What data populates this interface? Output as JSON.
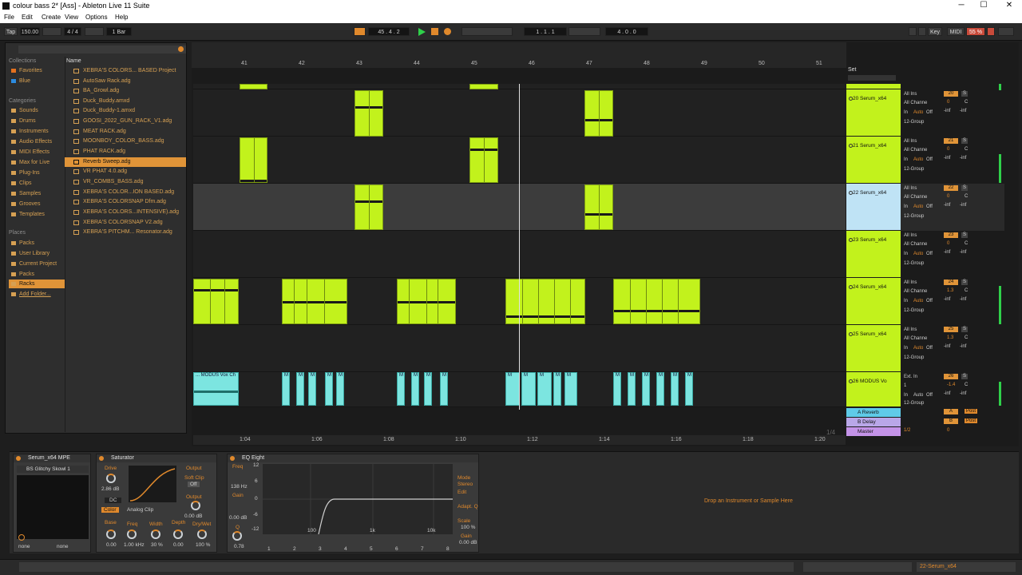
{
  "window": {
    "title": "colour bass 2* [Ass] - Ableton Live 11 Suite",
    "controls": [
      "─",
      "☐",
      "✕"
    ]
  },
  "menu": [
    "File",
    "Edit",
    "Create",
    "View",
    "Options",
    "Help"
  ],
  "controlbar": {
    "tap": "Tap",
    "tempo": "150.00",
    "signature": "4 / 4",
    "metro": "1 Bar",
    "position": "45 .  4 .  2",
    "loop_start": "1 .  1 .  1",
    "loop_length": "4 .  0 .  0",
    "key": "Key",
    "midi": "MIDI",
    "cpu": "55 %"
  },
  "browser": {
    "collections_head": "Collections",
    "collections": [
      {
        "label": "Favorites"
      },
      {
        "label": "Blue"
      }
    ],
    "categories_head": "Categories",
    "categories": [
      "Sounds",
      "Drums",
      "Instruments",
      "Audio Effects",
      "MIDI Effects",
      "Max for Live",
      "Plug-Ins",
      "Clips",
      "Samples",
      "Grooves",
      "Templates"
    ],
    "places_head": "Places",
    "places": [
      "Packs",
      "User Library",
      "Current Project",
      "Packs",
      "Racks",
      "Add Folder..."
    ],
    "name_head": "Name",
    "files": [
      "XEBRA'S COLORS... BASED Project",
      "AutoSaw Rack.adg",
      "BA_Growl.adg",
      "Duck_Buddy.amxd",
      "Duck_Buddy-1.amxd",
      "GOOSI_2022_GUN_RACK_V1.adg",
      "MEAT RACK.adg",
      "MOONBOY_COLOR_BASS.adg",
      "PHAT RACK.adg",
      "Reverb Sweep.adg",
      "VR PHAT 4.0.adg",
      "VR_COMBS_BASS.adg",
      "XEBRA'S COLOR...ION BASED.adg",
      "XEBRA'S COLORSNAP Dfm.adg",
      "XEBRA'S COLORS...INTENSIVE).adg",
      "XEBRA'S COLORSNAP V2.adg",
      "XEBRA'S PITCHM... Resonator.adg"
    ]
  },
  "arrangement": {
    "bars": [
      "41",
      "42",
      "43",
      "44",
      "45",
      "46",
      "47",
      "48",
      "49",
      "50",
      "51"
    ],
    "times": [
      "1:04",
      "1:06",
      "1:08",
      "1:10",
      "1:12",
      "1:14",
      "1:16",
      "1:18",
      "1:20"
    ],
    "zoom": "1/4",
    "set_label": "Set",
    "clip_label": "... MODUS Vox Ch",
    "clip_letter": "M"
  },
  "tracks": [
    {
      "name": "20 Serum_x64",
      "input": "All Ins",
      "channel": "All Channe",
      "group": "12-Group",
      "num": "20",
      "pan": "0",
      "vol": "-inf",
      "pv": "-inf"
    },
    {
      "name": "21 Serum_x64",
      "input": "All Ins",
      "channel": "All Channe",
      "group": "12-Group",
      "num": "21",
      "pan": "0",
      "vol": "-inf",
      "pv": "-inf"
    },
    {
      "name": "22 Serum_x64",
      "input": "All Ins",
      "channel": "All Channe",
      "group": "12-Group",
      "num": "22",
      "pan": "0",
      "vol": "-inf",
      "pv": "-inf"
    },
    {
      "name": "23 Serum_x64",
      "input": "All Ins",
      "channel": "All Channe",
      "group": "12-Group",
      "num": "23",
      "pan": "0",
      "vol": "-inf",
      "pv": "-inf"
    },
    {
      "name": "24 Serum_x64",
      "input": "All Ins",
      "channel": "All Channe",
      "group": "12-Group",
      "num": "24",
      "pan": "1.3",
      "vol": "-inf",
      "pv": "-inf"
    },
    {
      "name": "25 Serum_x64",
      "input": "All Ins",
      "channel": "All Channe",
      "group": "12-Group",
      "num": "25",
      "pan": "1.3",
      "vol": "-inf",
      "pv": "-inf"
    },
    {
      "name": "26 MODUS Vo",
      "input": "Ext. In",
      "channel": "1",
      "group": "12-Group",
      "num": "26",
      "pan": "-1.4",
      "vol": "-inf",
      "pv": "-inf"
    }
  ],
  "io": {
    "in": "In",
    "auto": "Auto",
    "off": "Off",
    "s": "S",
    "c": "C"
  },
  "returns": [
    {
      "name": "A Reverb",
      "letter": "A",
      "post": "Post"
    },
    {
      "name": "B Delay",
      "letter": "B",
      "post": "Post"
    },
    {
      "name": "Master",
      "letter": "1/2",
      "post": "0"
    }
  ],
  "devices": {
    "rack_title": "Serum_x64 MPE",
    "rack_chain": "BS Glitchy Skowl 1",
    "rack_left": "none",
    "rack_right": "none",
    "sat_title": "Saturator",
    "sat_drive": "Drive",
    "sat_drive_val": "2.86 dB",
    "sat_dc": "DC",
    "sat_output": "Output",
    "sat_softclip": "Soft Clip",
    "sat_softclip_val": "Off",
    "sat_output_val": "0.00 dB",
    "sat_color": "Color",
    "sat_mode": "Analog Clip",
    "sat_base": "Base",
    "sat_base_val": "0.00",
    "sat_freq": "Freq",
    "sat_freq_val": "1.00 kHz",
    "sat_width": "Width",
    "sat_width_val": "30 %",
    "sat_depth": "Depth",
    "sat_depth_val": "0.00",
    "sat_drywet": "Dry/Wet",
    "sat_drywet_val": "100 %",
    "eq_title": "EQ Eight",
    "eq_freq": "Freq",
    "eq_freq_val": "138 Hz",
    "eq_gain": "Gain",
    "eq_gain_val": "0.00 dB",
    "eq_q": "Q",
    "eq_q_val": "0.78",
    "eq_mode": "Mode",
    "eq_mode_val": "Stereo",
    "eq_edit": "Edit",
    "eq_adapt": "Adapt. Q",
    "eq_scale": "Scale",
    "eq_scale_val": "100 %",
    "eq_gain2": "Gain",
    "eq_gain2_val": "0.00 dB",
    "eq_db": [
      "12",
      "6",
      "0",
      "-6",
      "-12"
    ],
    "eq_hz": [
      "100",
      "1k",
      "10k"
    ],
    "eq_bands": [
      "1",
      "2",
      "3",
      "4",
      "5",
      "6",
      "7",
      "8"
    ],
    "drop_hint": "Drop an Instrument or Sample Here"
  },
  "status": {
    "track": "22-Serum_x64"
  },
  "colors": {
    "clip": "#c2f21c",
    "audio_clip": "#7ce5e0",
    "accent": "#e0892c"
  }
}
